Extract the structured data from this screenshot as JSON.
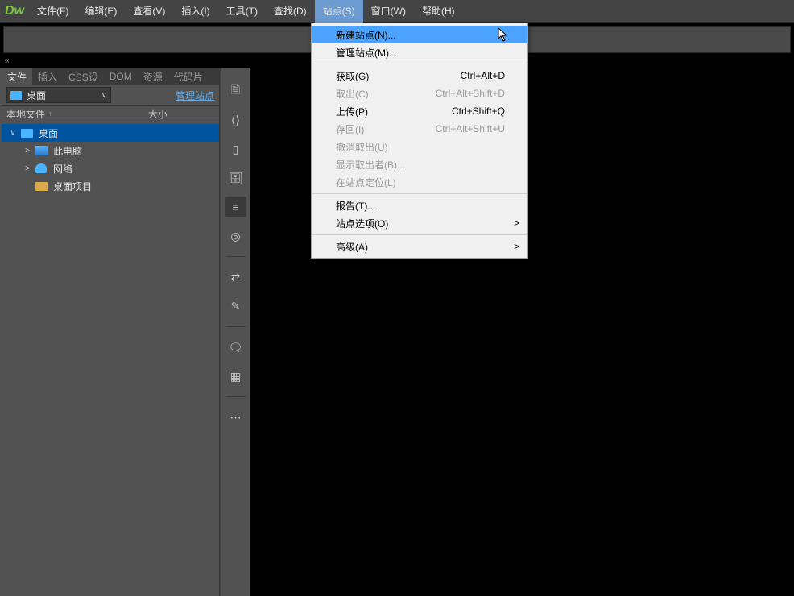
{
  "logo": "Dw",
  "menus": [
    "文件(F)",
    "编辑(E)",
    "查看(V)",
    "插入(I)",
    "工具(T)",
    "查找(D)",
    "站点(S)",
    "窗口(W)",
    "帮助(H)"
  ],
  "active_menu_index": 6,
  "collapse_glyph": "«",
  "tabs": [
    "文件",
    "插入",
    "CSS设",
    "DOM",
    "资源",
    "代码片"
  ],
  "active_tab_index": 0,
  "tabs_more_glyph": "≡",
  "location": {
    "label": "桌面"
  },
  "manage_link": "管理站点",
  "list_header": {
    "col1": "本地文件",
    "chev": "↑",
    "col2": "大小"
  },
  "tree": [
    {
      "depth": 0,
      "expander": "∨",
      "icon": "monitor",
      "label": "桌面",
      "selected": true
    },
    {
      "depth": 1,
      "expander": ">",
      "icon": "pc",
      "label": "此电脑",
      "selected": false
    },
    {
      "depth": 1,
      "expander": ">",
      "icon": "net",
      "label": "网络",
      "selected": false
    },
    {
      "depth": 1,
      "expander": "",
      "icon": "folder",
      "label": "桌面项目",
      "selected": false
    }
  ],
  "side_icons": [
    "doc-icon",
    "brackets-icon",
    "dsplit-icon",
    "db-find-icon",
    "lines-icon",
    "target-icon",
    "sep",
    "connect-icon",
    "wand-icon",
    "sep",
    "comment-icon",
    "panel-icon",
    "sep",
    "dots-icon"
  ],
  "active_side_index": 4,
  "dropdown": [
    {
      "label": "新建站点(N)...",
      "shortcut": "",
      "state": "hover"
    },
    {
      "label": "管理站点(M)...",
      "shortcut": "",
      "state": "normal"
    },
    {
      "sep": true
    },
    {
      "label": "获取(G)",
      "shortcut": "Ctrl+Alt+D",
      "state": "normal"
    },
    {
      "label": "取出(C)",
      "shortcut": "Ctrl+Alt+Shift+D",
      "state": "disabled"
    },
    {
      "label": "上传(P)",
      "shortcut": "Ctrl+Shift+Q",
      "state": "normal"
    },
    {
      "label": "存回(I)",
      "shortcut": "Ctrl+Alt+Shift+U",
      "state": "disabled"
    },
    {
      "label": "撤消取出(U)",
      "shortcut": "",
      "state": "disabled"
    },
    {
      "label": "显示取出者(B)...",
      "shortcut": "",
      "state": "disabled"
    },
    {
      "label": "在站点定位(L)",
      "shortcut": "",
      "state": "disabled"
    },
    {
      "sep": true
    },
    {
      "label": "报告(T)...",
      "shortcut": "",
      "state": "normal"
    },
    {
      "label": "站点选项(O)",
      "shortcut": "",
      "state": "normal",
      "submenu": true
    },
    {
      "sep": true
    },
    {
      "label": "高级(A)",
      "shortcut": "",
      "state": "normal",
      "submenu": true
    }
  ]
}
